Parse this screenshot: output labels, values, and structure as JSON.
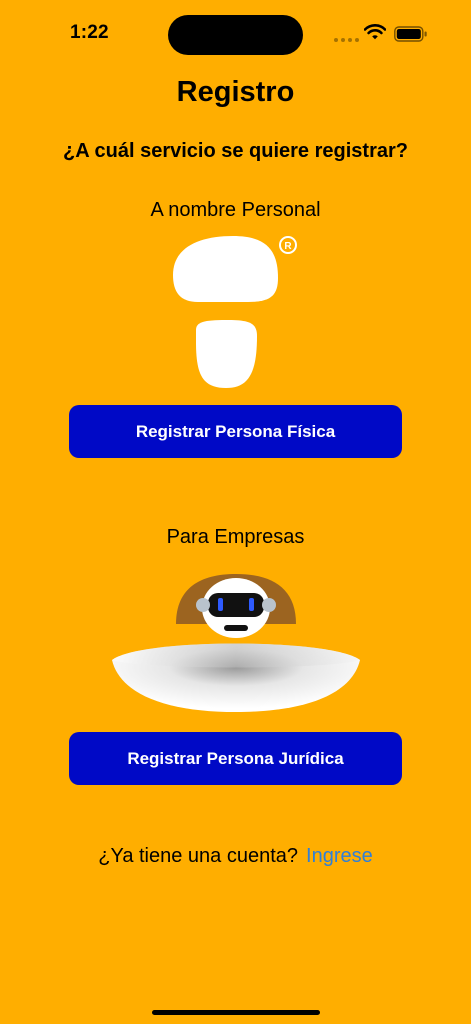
{
  "status_bar": {
    "time": "1:22"
  },
  "header": {
    "title": "Registro",
    "subtitle": "¿A cuál servicio se quiere registrar?"
  },
  "personal": {
    "label": "A nombre Personal",
    "registered_mark": "R",
    "button_label": "Registrar Persona Física"
  },
  "business": {
    "label": "Para Empresas",
    "button_label": "Registrar Persona Jurídica"
  },
  "footer": {
    "prompt": "¿Ya tiene una cuenta?",
    "link": "Ingrese"
  },
  "colors": {
    "background": "#FFAE00",
    "button": "#0009C6",
    "link": "#2F7FD8"
  }
}
